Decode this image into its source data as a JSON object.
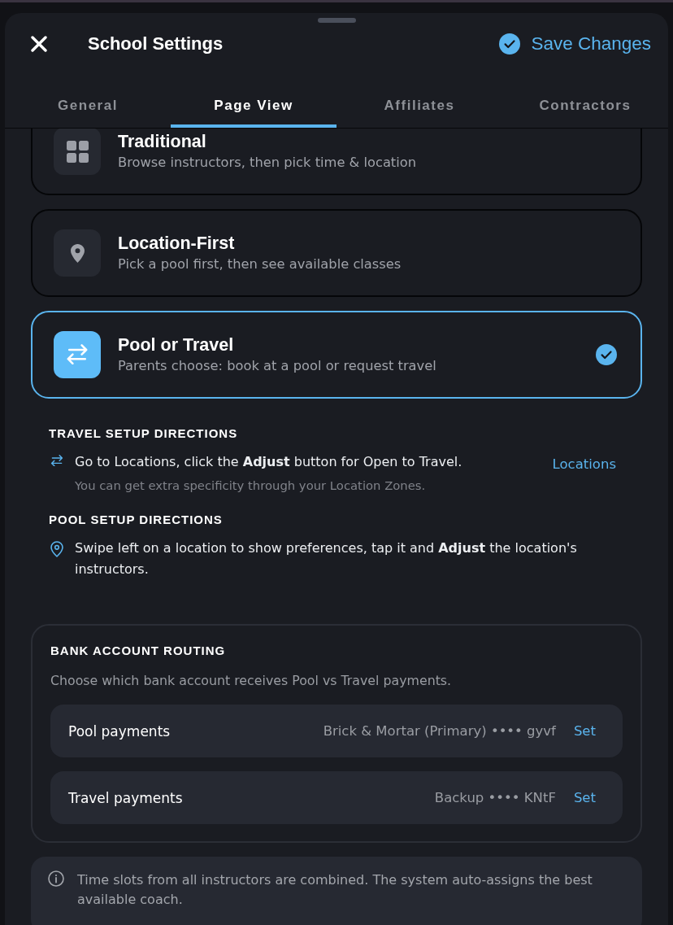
{
  "sheet": {
    "title": "School Settings",
    "save_label": "Save Changes"
  },
  "tabs": [
    {
      "label": "General",
      "selected": false
    },
    {
      "label": "Page View",
      "selected": true
    },
    {
      "label": "Affiliates",
      "selected": false
    },
    {
      "label": "Contractors",
      "selected": false
    }
  ],
  "view_options": [
    {
      "kind": "grid",
      "title": "Traditional",
      "description": "Browse instructors, then pick time & location",
      "selected": false
    },
    {
      "kind": "pin",
      "title": "Location-First",
      "description": "Pick a pool first, then see available classes",
      "selected": false
    },
    {
      "kind": "swap",
      "title": "Pool or Travel",
      "description": "Parents choose: book at a pool or request travel",
      "selected": true
    }
  ],
  "travel_setup": {
    "heading": "TRAVEL SETUP DIRECTIONS",
    "instruction": "Go to Locations, click the **Adjust** button for Open to Travel.",
    "link": "Locations",
    "note": "You can get extra specificity through your Location Zones."
  },
  "pool_setup": {
    "heading": "POOL SETUP DIRECTIONS",
    "instruction": "Swipe left on a location to show preferences, tap it and **Adjust** the location's instructors."
  },
  "bank_routing": {
    "heading": "BANK ACCOUNT ROUTING",
    "description": "Choose which bank account receives Pool vs Travel payments.",
    "rows": [
      {
        "label": "Pool payments",
        "account": "Brick & Mortar (Primary) •••• gyvf",
        "action": "Set"
      },
      {
        "label": "Travel payments",
        "account": "Backup •••• KNtF",
        "action": "Set"
      }
    ]
  },
  "info_note": "Time slots from all instructors are combined. The system auto-assigns the best available coach."
}
